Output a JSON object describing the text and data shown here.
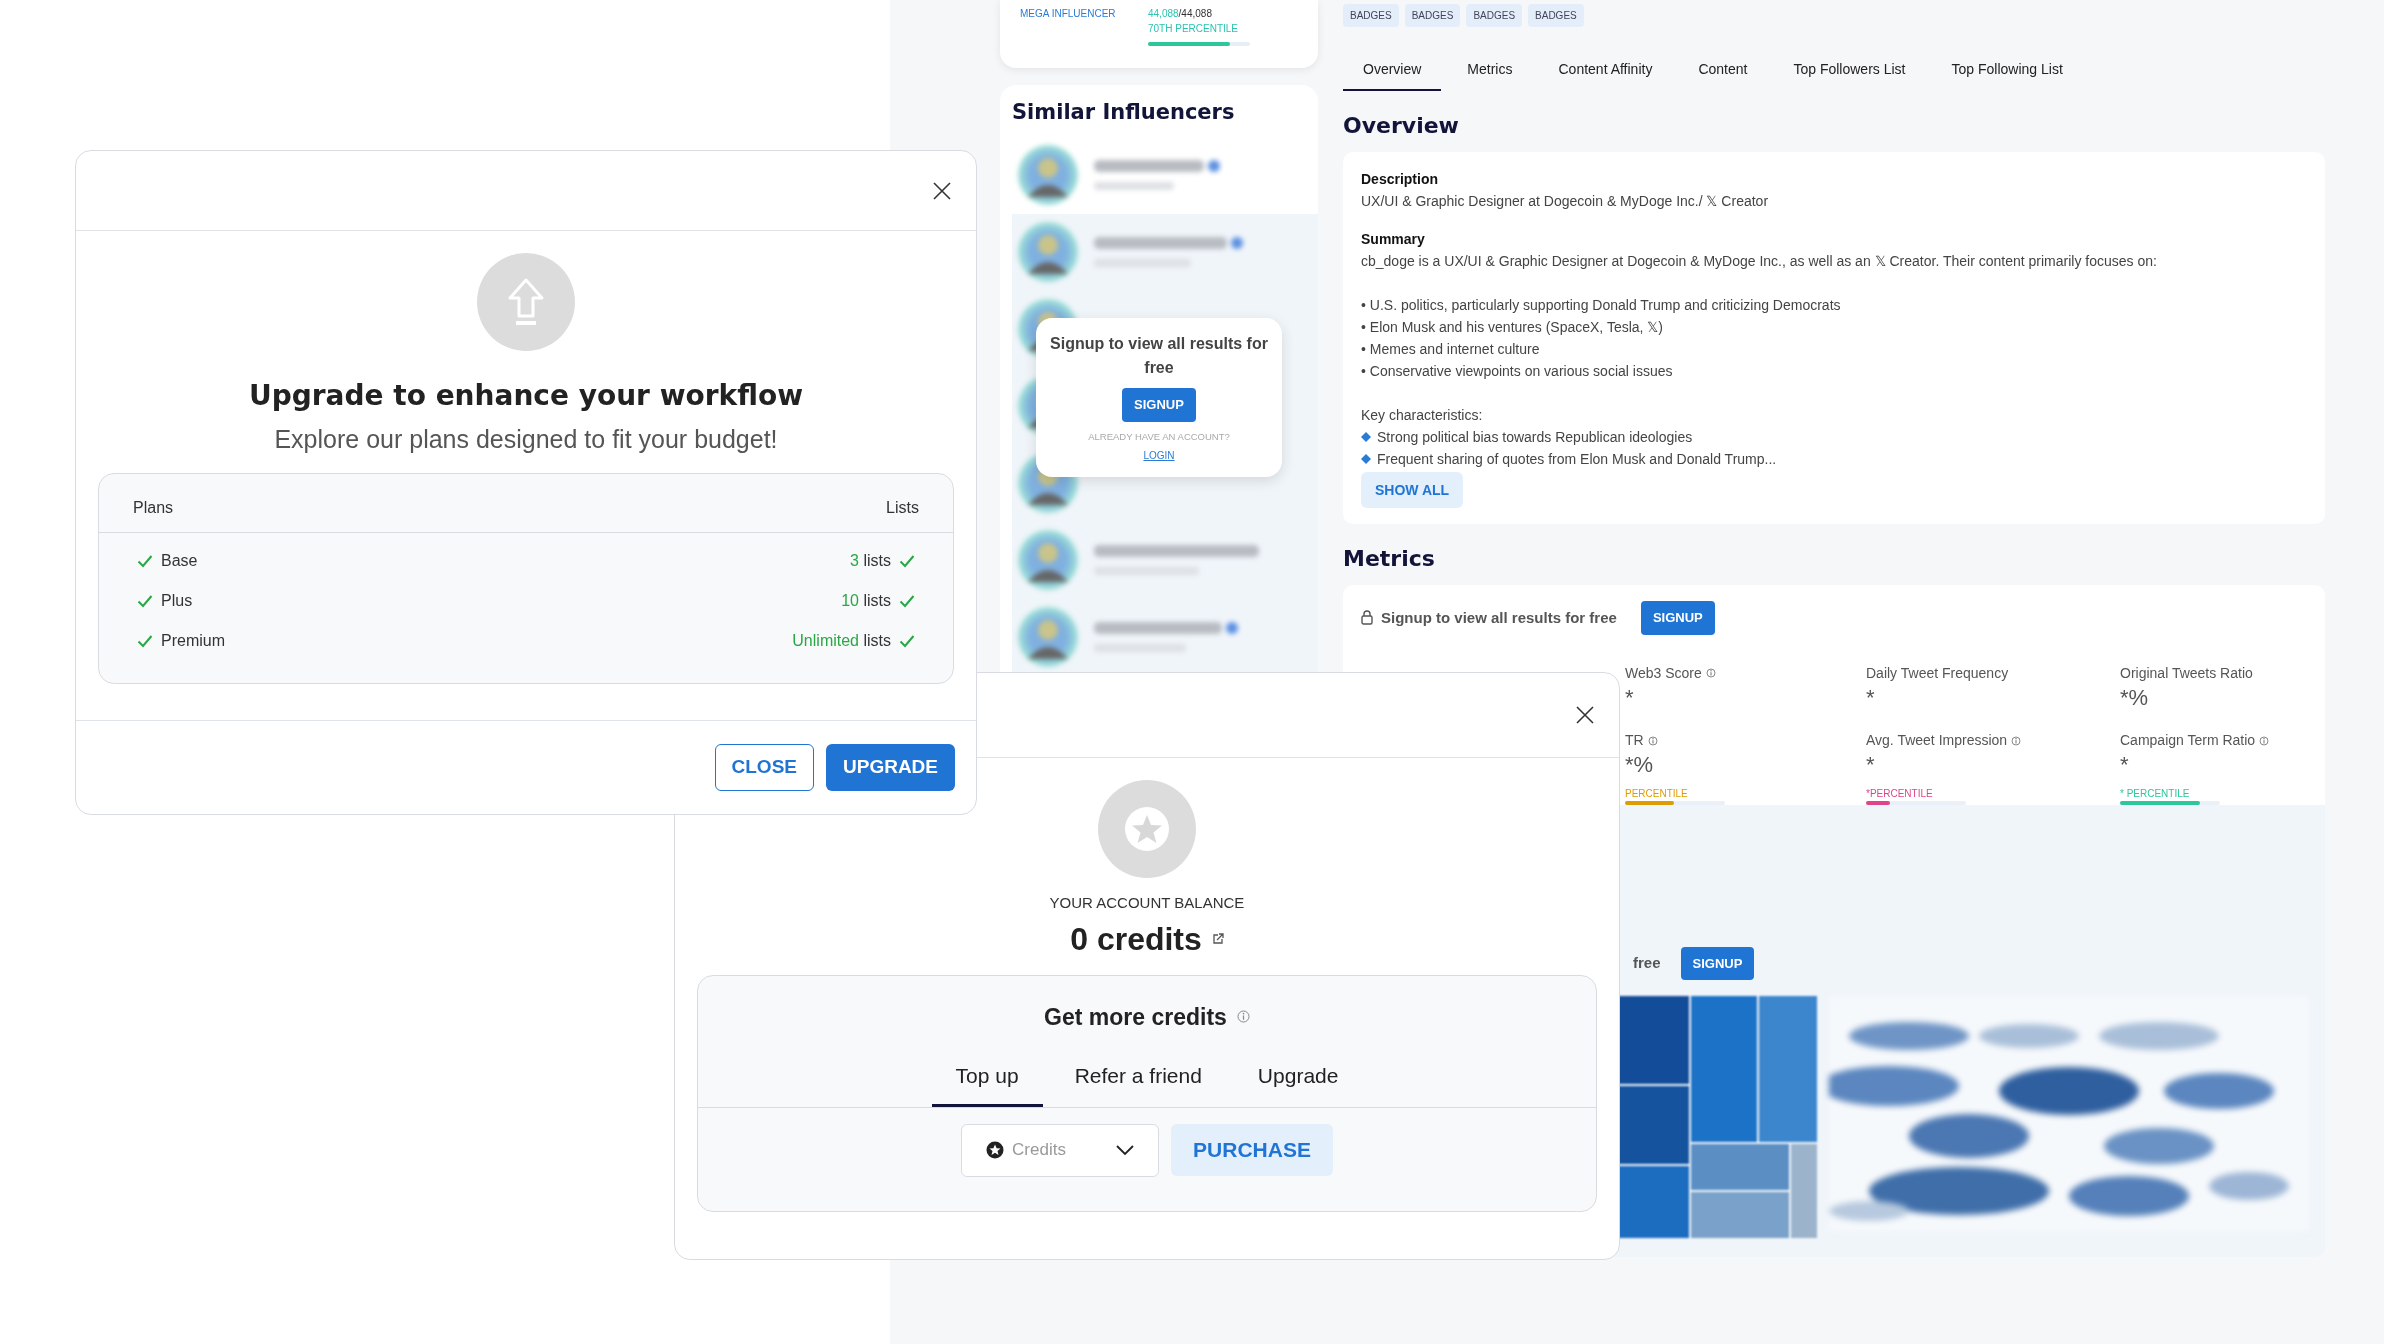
{
  "profile_card": {
    "tier": "MEGA INFLUENCER",
    "followers": "44,088",
    "followers_total": "/44,088",
    "percentile": "70TH PERCENTILE",
    "level": 0.8
  },
  "similar_influencers": {
    "title": "Similar Influencers",
    "rows": [
      {
        "verified": true
      },
      {
        "verified": true
      },
      {
        "kind": "covered"
      },
      {
        "kind": "covered"
      },
      {
        "kind": "covered"
      },
      {
        "verified": false
      },
      {
        "verified": true
      }
    ],
    "signup_popup": {
      "title": "Signup to view all results for free",
      "button": "SIGNUP",
      "prompt": "ALREADY HAVE AN ACCOUNT?",
      "link": "LOGIN"
    }
  },
  "badges": [
    "BADGES",
    "BADGES",
    "BADGES",
    "BADGES"
  ],
  "tabs": [
    {
      "label": "Overview",
      "selected": true
    },
    {
      "label": "Metrics",
      "selected": false
    },
    {
      "label": "Content Affinity",
      "selected": false
    },
    {
      "label": "Content",
      "selected": false
    },
    {
      "label": "Top Followers List",
      "selected": false
    },
    {
      "label": "Top Following List",
      "selected": false
    }
  ],
  "overview": {
    "title": "Overview",
    "description_label": "Description",
    "description": "UX/UI & Graphic Designer at Dogecoin & MyDoge Inc./ 𝕏 Creator",
    "summary_label": "Summary",
    "summary": "cb_doge is a UX/UI & Graphic Designer at Dogecoin & MyDoge Inc., as well as an 𝕏 Creator. Their content primarily focuses on:",
    "points": [
      "• U.S. politics, particularly supporting Donald Trump and criticizing Democrats",
      "• Elon Musk and his ventures (SpaceX, Tesla, 𝕏)",
      "• Memes and internet culture",
      "• Conservative viewpoints on various social issues"
    ],
    "characteristics_label": "Key characteristics:",
    "characteristics": [
      "Strong political bias towards Republican ideologies",
      "Frequent sharing of quotes from Elon Musk and Donald Trump..."
    ],
    "button": "SHOW ALL"
  },
  "metrics": {
    "title": "Metrics",
    "lock_text": "Signup to view all results for free",
    "button": "SIGNUP",
    "items": [
      {
        "label": "Web3 Score",
        "info": true,
        "value": "*"
      },
      {
        "label": "Daily Tweet Frequency",
        "info": false,
        "value": "*"
      },
      {
        "label": "Original Tweets Ratio",
        "info": false,
        "value": "*%"
      },
      {
        "label": "TR",
        "info": true,
        "value": "*%",
        "percentile": "PERCENTILE",
        "level": 0.49,
        "color": "#dd9c00"
      },
      {
        "label": "Avg. Tweet Impression",
        "info": true,
        "value": "*",
        "percentile": "*PERCENTILE",
        "level": 0.24,
        "color": "#e0458c"
      },
      {
        "label": "Campaign Term Ratio",
        "info": true,
        "value": "*",
        "percentile": "*  PERCENTILE",
        "level": 0.8,
        "color": "#2cc79a"
      }
    ]
  },
  "content_affinity": {
    "lock_text": "free",
    "button": "SIGNUP"
  },
  "upgrade_modal": {
    "title": "Upgrade to enhance your workflow",
    "subtitle": "Explore our plans designed to fit your budget!",
    "plans_header": "Plans",
    "lists_header": "Lists",
    "plans": [
      {
        "name": "Base",
        "count": "3",
        "unit": "lists",
        "included": true
      },
      {
        "name": "Plus",
        "count": "10",
        "unit": "lists",
        "included": true
      },
      {
        "name": "Premium",
        "count": "Unlimited",
        "unit": "lists",
        "included": true
      }
    ],
    "close_button": "CLOSE",
    "upgrade_button": "UPGRADE"
  },
  "credits_modal": {
    "balance_label": "YOUR ACCOUNT BALANCE",
    "balance": "0 credits",
    "get_more": "Get more credits",
    "tabs": [
      {
        "label": "Top up",
        "selected": true
      },
      {
        "label": "Refer a friend",
        "selected": false
      },
      {
        "label": "Upgrade",
        "selected": false
      }
    ],
    "select_placeholder": "Credits",
    "purchase_button": "PURCHASE"
  }
}
